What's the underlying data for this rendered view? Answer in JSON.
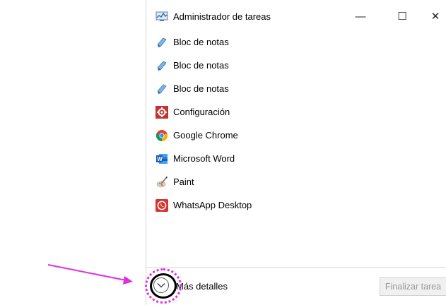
{
  "window": {
    "title": "Administrador de tareas",
    "controls": {
      "minimize": "—",
      "maximize": "☐",
      "close": "✕"
    }
  },
  "apps": [
    {
      "label": "Bloc de notas",
      "icon": "notepad-icon"
    },
    {
      "label": "Bloc de notas",
      "icon": "notepad-icon"
    },
    {
      "label": "Bloc de notas",
      "icon": "notepad-icon"
    },
    {
      "label": "Configuración",
      "icon": "settings-icon"
    },
    {
      "label": "Google Chrome",
      "icon": "chrome-icon"
    },
    {
      "label": "Microsoft Word",
      "icon": "word-icon"
    },
    {
      "label": "Paint",
      "icon": "paint-icon"
    },
    {
      "label": "WhatsApp Desktop",
      "icon": "whatsapp-icon"
    }
  ],
  "footer": {
    "more_details_label": "Más detalles",
    "end_task_label": "Finalizar tarea"
  },
  "annotation": {
    "color": "#e02ee0"
  }
}
